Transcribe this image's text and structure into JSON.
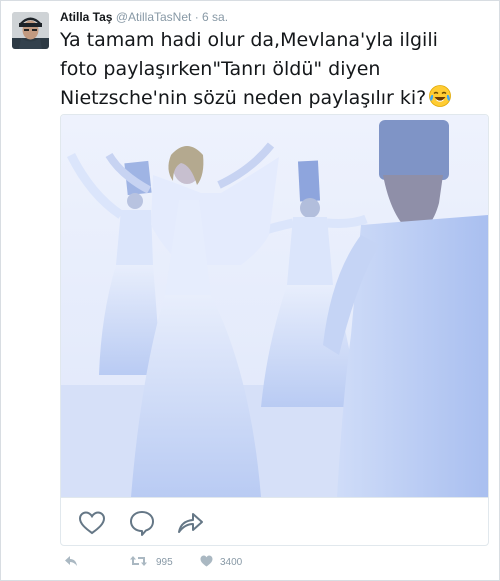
{
  "tweet": {
    "author_name": "Atilla Taş",
    "handle": "@AtillaTasNet",
    "separator": "·",
    "time": "6 sa.",
    "text_lines": [
      "Ya tamam hadi olur da,Mevlana'yla ilgili",
      "foto paylaşırken\"Tanrı öldü\" diyen",
      "Nietzsche'nin sözü neden paylaşılır ki?"
    ],
    "emoji": "face-with-tears-of-joy-icon"
  },
  "media": {
    "type": "photo",
    "actions": [
      "heart-outline-icon",
      "comment-bubble-icon",
      "share-arrow-icon"
    ]
  },
  "footer": {
    "reply_icon": "reply-icon",
    "retweet_icon": "retweet-icon",
    "retweet_count": "995",
    "like_icon": "heart-filled-icon",
    "like_count": "3400"
  },
  "colors": {
    "text": "#14171a",
    "muted": "#8899a6",
    "border": "#e1e8ed",
    "photo_sky": "#e6ecfb",
    "photo_robe": "#c9d8f7"
  }
}
